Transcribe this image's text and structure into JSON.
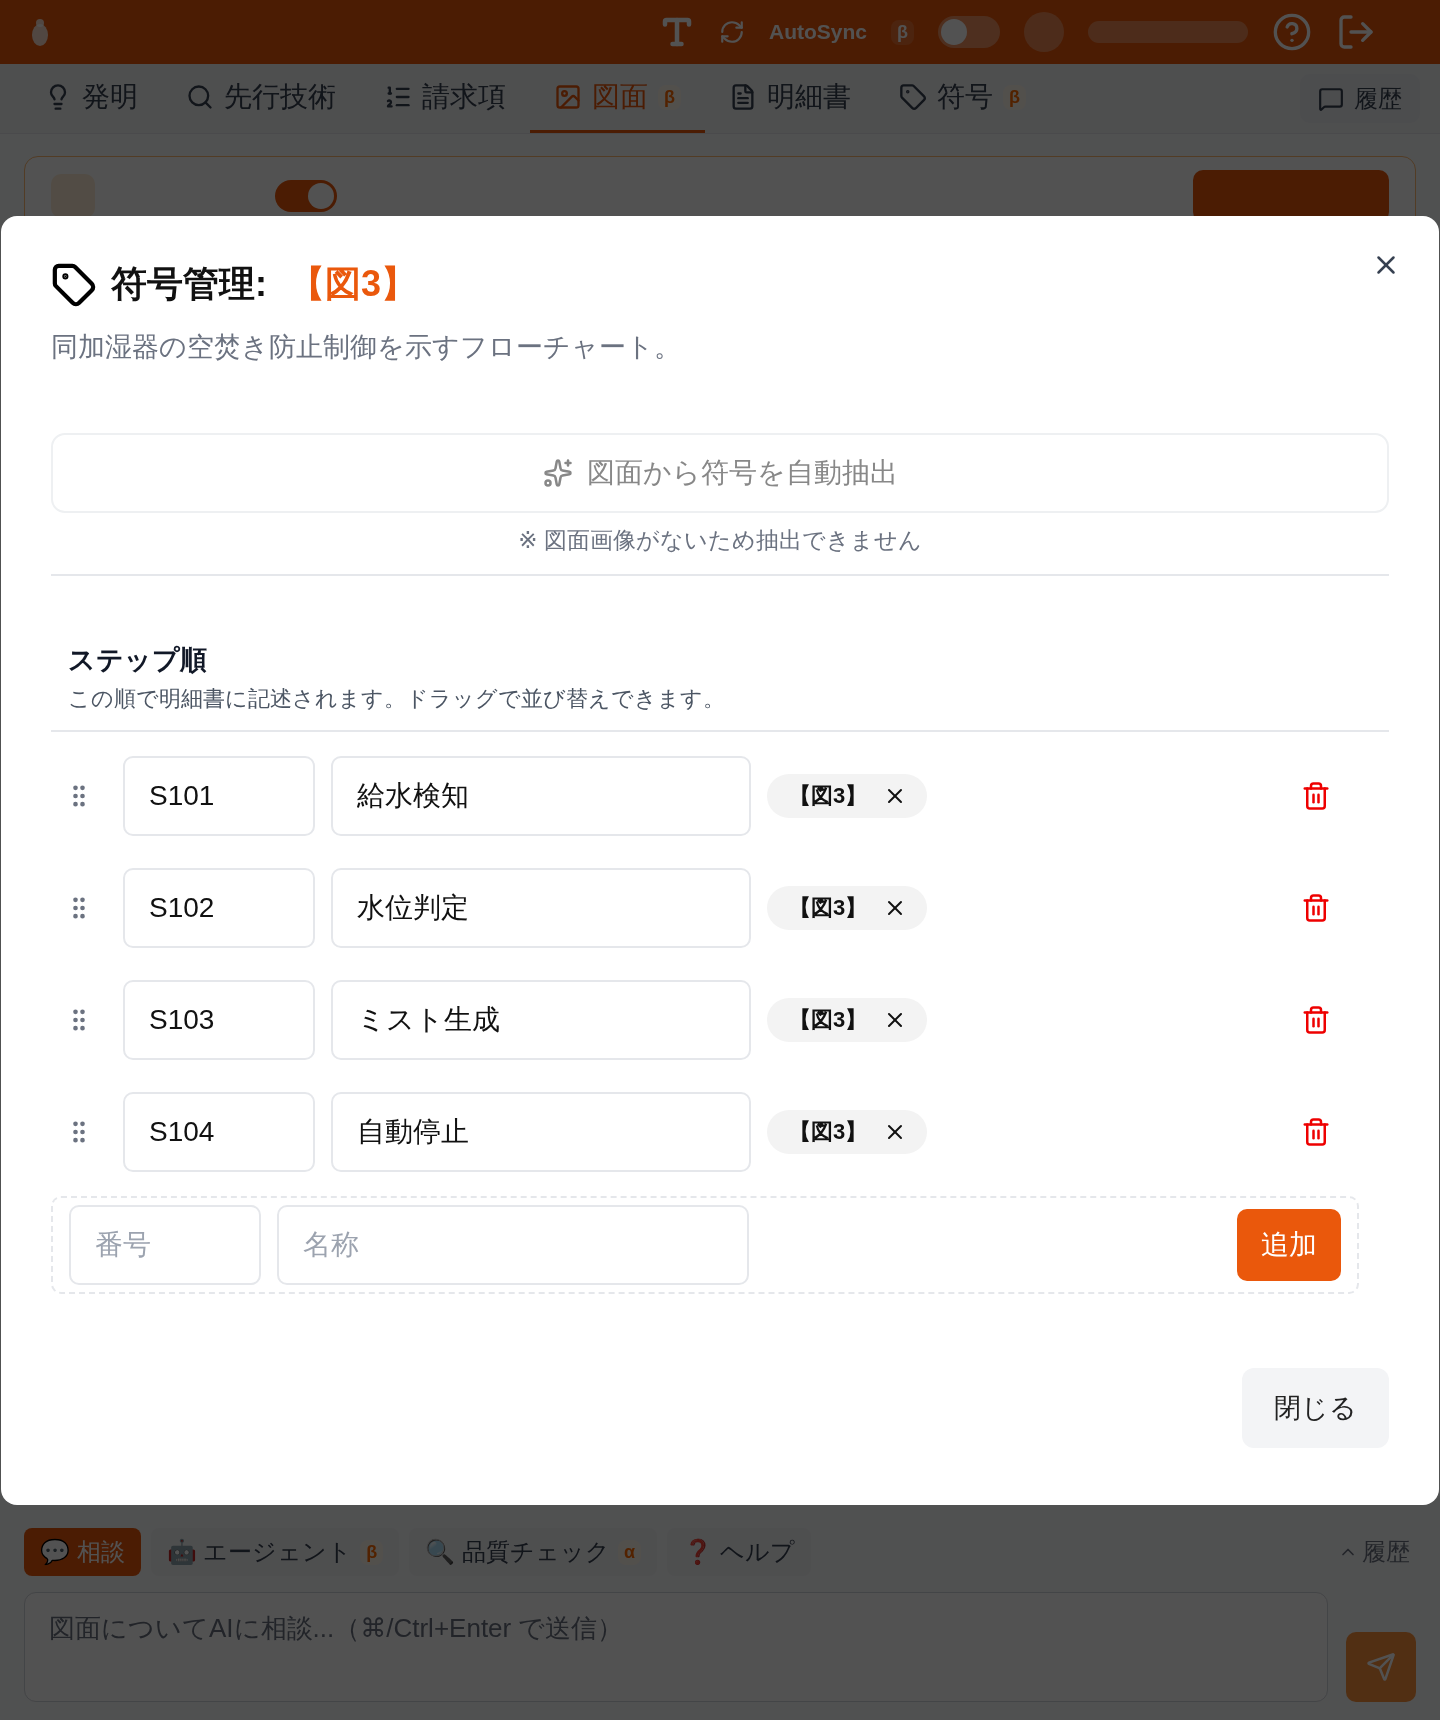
{
  "top_bar": {
    "autosync_label": "AutoSync",
    "autosync_badge": "β",
    "autosync_on": false
  },
  "tabs": [
    {
      "label": "発明",
      "selected": false
    },
    {
      "label": "先行技術",
      "selected": false
    },
    {
      "label": "請求項",
      "selected": false
    },
    {
      "label": "図面",
      "badge": "β",
      "selected": true
    },
    {
      "label": "明細書",
      "selected": false
    },
    {
      "label": "符号",
      "badge": "β",
      "selected": false
    }
  ],
  "history_button": "履歴",
  "drawing_card": {
    "toggle_on": true
  },
  "modal": {
    "title": "符号管理:",
    "title_ref": "【図3】",
    "description": "同加湿器の空焚き防止制御を示すフローチャート。",
    "extract_button": "図面から符号を自動抽出",
    "extract_note": "※ 図面画像がないため抽出できません",
    "section_title": "ステップ順",
    "section_note": "この順で明細書に記述されます。ドラッグで並び替えできます。",
    "steps": [
      {
        "number": "S101",
        "name": "給水検知",
        "tag": "【図3】"
      },
      {
        "number": "S102",
        "name": "水位判定",
        "tag": "【図3】"
      },
      {
        "number": "S103",
        "name": "ミスト生成",
        "tag": "【図3】"
      },
      {
        "number": "S104",
        "name": "自動停止",
        "tag": "【図3】"
      }
    ],
    "new_step": {
      "number_placeholder": "番号",
      "name_placeholder": "名称",
      "add_button": "追加"
    },
    "close_button": "閉じる"
  },
  "chat": {
    "tabs": [
      {
        "icon": "💬",
        "label": "相談",
        "selected": true
      },
      {
        "icon": "🤖",
        "label": "エージェント",
        "badge": "β",
        "selected": false
      },
      {
        "icon": "🔍",
        "label": "品質チェック",
        "badge": "α",
        "selected": false
      },
      {
        "icon": "❓",
        "label": "ヘルプ",
        "selected": false
      }
    ],
    "history": "履歴",
    "placeholder": "図面についてAIに相談...（⌘/Ctrl+Enter で送信）"
  }
}
